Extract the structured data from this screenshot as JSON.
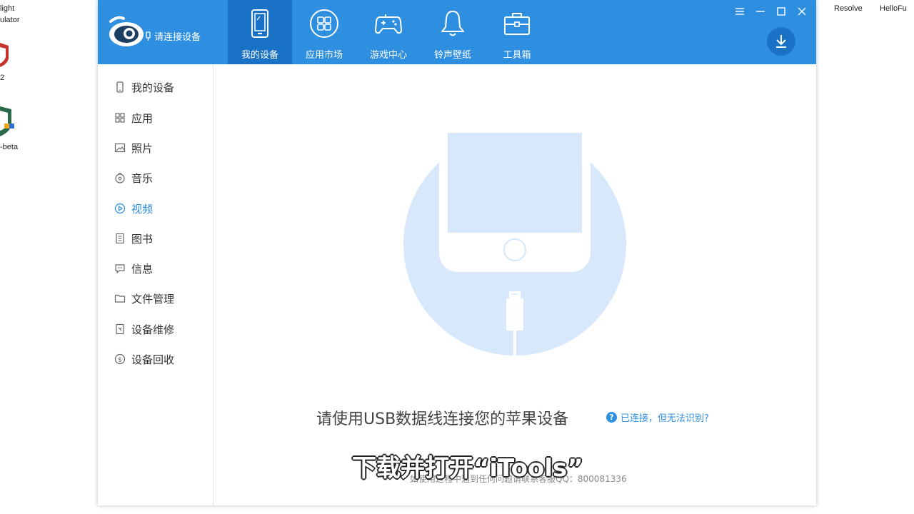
{
  "desktop": {
    "items_left": [
      "light",
      "ulator",
      "2",
      "-beta"
    ],
    "items_right": [
      "Resolve",
      "HelloFu"
    ]
  },
  "app": {
    "connect_label": "请连接设备",
    "tabs": [
      {
        "label": "我的设备",
        "icon": "phone-icon",
        "active": true
      },
      {
        "label": "应用市场",
        "icon": "grid-icon",
        "active": false
      },
      {
        "label": "游戏中心",
        "icon": "gamepad-icon",
        "active": false
      },
      {
        "label": "铃声壁纸",
        "icon": "bell-icon",
        "active": false
      },
      {
        "label": "工具箱",
        "icon": "toolbox-icon",
        "active": false
      }
    ],
    "sidebar": [
      {
        "label": "我的设备",
        "icon": "device-icon"
      },
      {
        "label": "应用",
        "icon": "apps-icon"
      },
      {
        "label": "照片",
        "icon": "photo-icon"
      },
      {
        "label": "音乐",
        "icon": "music-icon"
      },
      {
        "label": "视频",
        "icon": "video-icon",
        "active": true
      },
      {
        "label": "图书",
        "icon": "book-icon"
      },
      {
        "label": "信息",
        "icon": "message-icon"
      },
      {
        "label": "文件管理",
        "icon": "folder-icon"
      },
      {
        "label": "设备维修",
        "icon": "repair-icon"
      },
      {
        "label": "设备回收",
        "icon": "recycle-icon"
      }
    ],
    "main": {
      "prompt": "请使用USB数据线连接您的苹果设备",
      "help_link": "已连接，但无法识别?",
      "footer": "如使用过程中遇到任何问题请联系客服QQ：800081336"
    },
    "colors": {
      "accent": "#2e8fe0",
      "accent_dark": "#1a72c6",
      "illustration": "#d6e8fa"
    }
  },
  "subtitle": "下载并打开“iTools”"
}
